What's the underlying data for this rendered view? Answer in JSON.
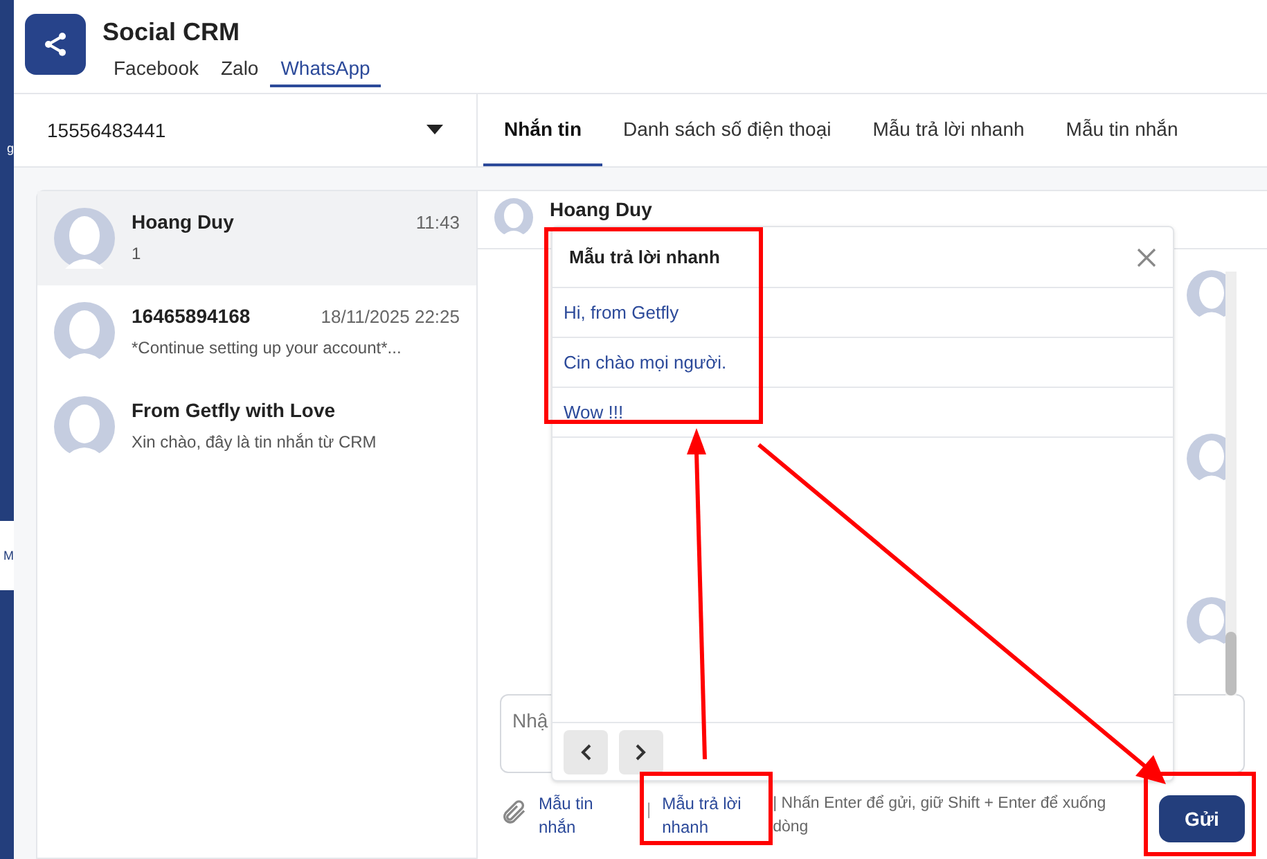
{
  "sidebar": {
    "items": [
      {
        "label": "g",
        "selected": false
      },
      {
        "label": "M",
        "selected": true
      }
    ]
  },
  "app": {
    "title": "Social CRM"
  },
  "channel_tabs": [
    {
      "label": "Facebook",
      "selected": false
    },
    {
      "label": "Zalo",
      "selected": false
    },
    {
      "label": "WhatsApp",
      "selected": true
    }
  ],
  "phone_select": {
    "value": "15556483441"
  },
  "section_tabs": [
    {
      "label": "Nhắn tin",
      "selected": true
    },
    {
      "label": "Danh sách số điện thoại",
      "selected": false
    },
    {
      "label": "Mẫu trả lời nhanh",
      "selected": false
    },
    {
      "label": "Mẫu tin nhắn",
      "selected": false
    }
  ],
  "conversations": [
    {
      "name": "Hoang Duy",
      "time": "11:43",
      "preview": "1",
      "selected": true
    },
    {
      "name": "16465894168",
      "time": "18/11/2025 22:25",
      "preview": "*Continue setting up your account*...",
      "selected": false
    },
    {
      "name": "From Getfly with Love",
      "preview": "Xin chào, đây là tin nhắn từ CRM",
      "selected": false
    }
  ],
  "chat": {
    "contact": "Hoang Duy",
    "composer_placeholder": "Nhậ",
    "attach_link": "Mẫu tin nhắn",
    "separator": "|",
    "quick_reply_link": "Mẫu trả lời nhanh",
    "hint": "| Nhấn Enter để gửi, giữ Shift + Enter để xuống dòng",
    "send": "Gửi"
  },
  "quick_reply_popup": {
    "title": "Mẫu trả lời nhanh",
    "items": [
      "Hi, from Getfly",
      "Cin chào mọi người.",
      "Wow !!!"
    ]
  }
}
